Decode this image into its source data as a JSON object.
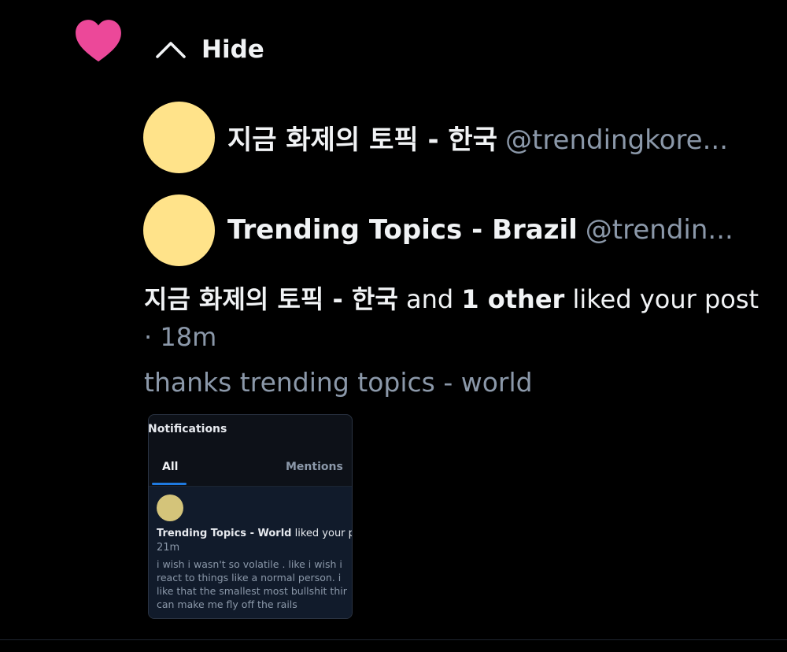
{
  "icons": {
    "like": "heart-icon",
    "collapse": "chevron-up-icon"
  },
  "colors": {
    "heart": "#ec4899",
    "avatar": "#ffe38a",
    "muted_text": "#8b98a9",
    "tab_accent": "#1f7ae0"
  },
  "hide_button": {
    "label": "Hide"
  },
  "likers": [
    {
      "display_name": "지금 화제의 토픽 - 한국",
      "handle": "@trendingkore..."
    },
    {
      "display_name": "Trending Topics - Brazil",
      "handle": "@trendin..."
    }
  ],
  "summary": {
    "actor": "지금 화제의 토픽 - 한국",
    "conj": "and",
    "others": "1 other",
    "action": "liked your post",
    "sep": "·",
    "time": "18m"
  },
  "post": {
    "text": "thanks trending topics - world"
  },
  "embed": {
    "title": "Notifications",
    "tabs": [
      "All",
      "Mentions"
    ],
    "item": {
      "actor": "Trending Topics - World",
      "action": "liked your po",
      "time": "21m",
      "body_lines": [
        "i wish i wasn't so volatile . like i wish i",
        "react to things like a normal person. i",
        "like that the smallest most bullshit thir",
        "can make me fly off the rails"
      ]
    }
  }
}
